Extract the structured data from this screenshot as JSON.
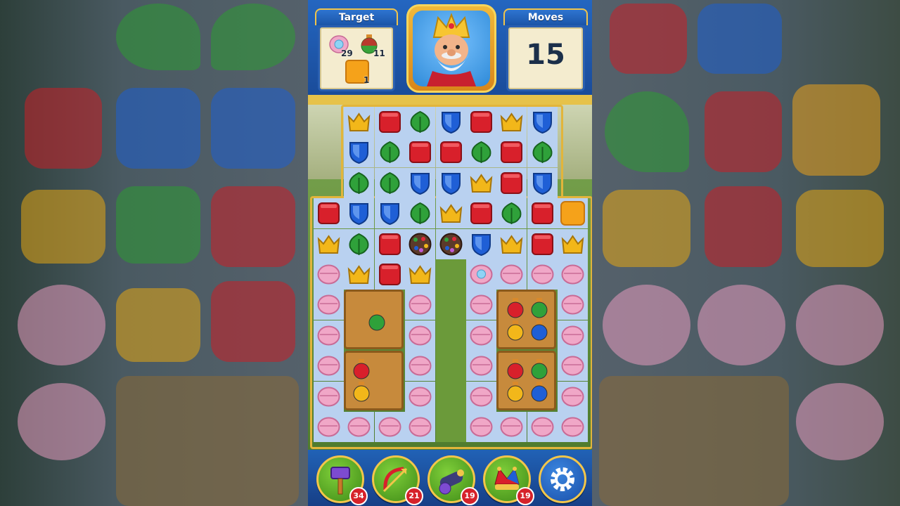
{
  "header": {
    "target_label": "Target",
    "moves_label": "Moves",
    "moves_value": "15",
    "targets": [
      {
        "icon": "shell-pearl-icon",
        "count": "29"
      },
      {
        "icon": "potion-jar-icon",
        "count": "11"
      },
      {
        "icon": "orange-block-icon",
        "count": "1"
      }
    ]
  },
  "boosters": [
    {
      "icon": "hammer-icon",
      "count": "34"
    },
    {
      "icon": "arrow-icon",
      "count": "21"
    },
    {
      "icon": "cannon-icon",
      "count": "19"
    },
    {
      "icon": "jester-hat-icon",
      "count": "19"
    },
    {
      "icon": "settings-gear-icon",
      "count": ""
    }
  ],
  "colors": {
    "red": "#d8202b",
    "blue": "#1f5fd6",
    "green": "#2fa13a",
    "yellow": "#f2b71a",
    "pink": "#f0a7c7",
    "orange": "#f5a21a",
    "crate": "#c78a3c"
  },
  "board": {
    "rows": [
      [
        "_",
        "crown",
        "book",
        "leaf",
        "shield",
        "book",
        "crown",
        "shield",
        "_"
      ],
      [
        "_",
        "shield",
        "leaf",
        "book",
        "book",
        "leaf",
        "book",
        "leaf",
        "_"
      ],
      [
        "_",
        "leaf",
        "leaf",
        "shield",
        "shield",
        "crown",
        "book",
        "shield",
        "_"
      ],
      [
        "book",
        "shield",
        "shield",
        "leaf",
        "crown",
        "book",
        "leaf",
        "book",
        "orange"
      ],
      [
        "crown",
        "leaf",
        "book",
        "ball",
        "ball",
        "shield",
        "crown",
        "book",
        "crown"
      ],
      [
        "shell",
        "crown",
        "book",
        "crown",
        "gap",
        "shell-pearl",
        "shell",
        "shell",
        "shell"
      ],
      [
        "shell",
        "crate",
        "crate",
        "shell",
        "gap",
        "shell",
        "crate",
        "crate",
        "shell"
      ],
      [
        "shell",
        "crate",
        "crate",
        "shell",
        "gap",
        "shell",
        "crate",
        "crate",
        "shell"
      ],
      [
        "shell",
        "crate",
        "crate",
        "shell",
        "gap",
        "shell",
        "crate",
        "crate",
        "shell"
      ],
      [
        "shell",
        "crate",
        "crate",
        "shell",
        "gap",
        "shell",
        "crate",
        "crate",
        "shell"
      ],
      [
        "shell",
        "shell",
        "shell",
        "shell",
        "gap",
        "shell",
        "shell",
        "shell",
        "shell"
      ]
    ]
  }
}
